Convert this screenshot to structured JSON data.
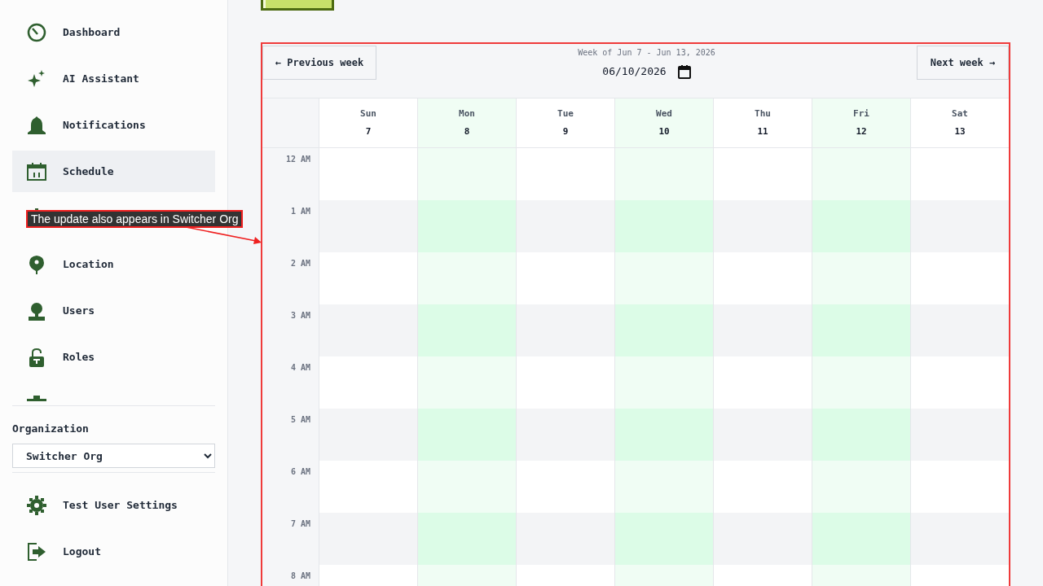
{
  "sidebar": {
    "items": [
      {
        "kind": "dashboard",
        "label": "Dashboard",
        "selected": false
      },
      {
        "kind": "sparkle",
        "label": "AI Assistant",
        "selected": false
      },
      {
        "kind": "bell",
        "label": "Notifications",
        "selected": false
      },
      {
        "kind": "calendar",
        "label": "Schedule",
        "selected": true
      },
      {
        "kind": "tree",
        "selected": false
      },
      {
        "kind": "pin",
        "label": "Location",
        "selected": false
      },
      {
        "kind": "user",
        "label": "Users",
        "selected": false
      },
      {
        "kind": "lock",
        "label": "Roles",
        "selected": false
      },
      {
        "kind": "partial",
        "selected": false
      }
    ],
    "organization": {
      "label": "Organization",
      "value": "Switcher Org"
    },
    "footer_items": [
      {
        "kind": "gear",
        "label": "Test User Settings"
      },
      {
        "kind": "logout",
        "label": "Logout"
      }
    ]
  },
  "calendar": {
    "previous_button": "← Previous week",
    "next_button": "Next week →",
    "week_label": "Week of Jun 7 - Jun 13, 2026",
    "date_value": "06/10/2026",
    "days": [
      {
        "name": "Sun",
        "date": "7",
        "highlighted": false
      },
      {
        "name": "Mon",
        "date": "8",
        "highlighted": true
      },
      {
        "name": "Tue",
        "date": "9",
        "highlighted": false
      },
      {
        "name": "Wed",
        "date": "10",
        "highlighted": true
      },
      {
        "name": "Thu",
        "date": "11",
        "highlighted": false
      },
      {
        "name": "Fri",
        "date": "12",
        "highlighted": true
      },
      {
        "name": "Sat",
        "date": "13",
        "highlighted": false
      }
    ],
    "hours": [
      "12 AM",
      "1 AM",
      "2 AM",
      "3 AM",
      "4 AM",
      "5 AM",
      "6 AM",
      "7 AM",
      "8 AM"
    ]
  },
  "annotation": {
    "text": "The update also appears in Switcher Org"
  }
}
